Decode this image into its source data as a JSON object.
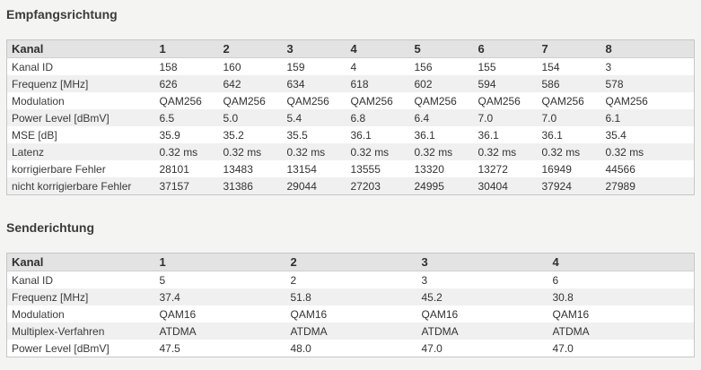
{
  "downstream": {
    "title": "Empfangsrichtung",
    "header": [
      "Kanal",
      "1",
      "2",
      "3",
      "4",
      "5",
      "6",
      "7",
      "8"
    ],
    "rows": [
      [
        "Kanal ID",
        "158",
        "160",
        "159",
        "4",
        "156",
        "155",
        "154",
        "3"
      ],
      [
        "Frequenz [MHz]",
        "626",
        "642",
        "634",
        "618",
        "602",
        "594",
        "586",
        "578"
      ],
      [
        "Modulation",
        "QAM256",
        "QAM256",
        "QAM256",
        "QAM256",
        "QAM256",
        "QAM256",
        "QAM256",
        "QAM256"
      ],
      [
        "Power Level [dBmV]",
        "6.5",
        "5.0",
        "5.4",
        "6.8",
        "6.4",
        "7.0",
        "7.0",
        "6.1"
      ],
      [
        "MSE [dB]",
        "35.9",
        "35.2",
        "35.5",
        "36.1",
        "36.1",
        "36.1",
        "36.1",
        "35.4"
      ],
      [
        "Latenz",
        "0.32 ms",
        "0.32 ms",
        "0.32 ms",
        "0.32 ms",
        "0.32 ms",
        "0.32 ms",
        "0.32 ms",
        "0.32 ms"
      ],
      [
        "korrigierbare Fehler",
        "28101",
        "13483",
        "13154",
        "13555",
        "13320",
        "13272",
        "16949",
        "44566"
      ],
      [
        "nicht korrigierbare Fehler",
        "37157",
        "31386",
        "29044",
        "27203",
        "24995",
        "30404",
        "37924",
        "27989"
      ]
    ]
  },
  "upstream": {
    "title": "Senderichtung",
    "header": [
      "Kanal",
      "1",
      "2",
      "3",
      "4"
    ],
    "rows": [
      [
        "Kanal ID",
        "5",
        "2",
        "3",
        "6"
      ],
      [
        "Frequenz [MHz]",
        "37.4",
        "51.8",
        "45.2",
        "30.8"
      ],
      [
        "Modulation",
        "QAM16",
        "QAM16",
        "QAM16",
        "QAM16"
      ],
      [
        "Multiplex-Verfahren",
        "ATDMA",
        "ATDMA",
        "ATDMA",
        "ATDMA"
      ],
      [
        "Power Level [dBmV]",
        "47.5",
        "48.0",
        "47.0",
        "47.0"
      ]
    ]
  }
}
